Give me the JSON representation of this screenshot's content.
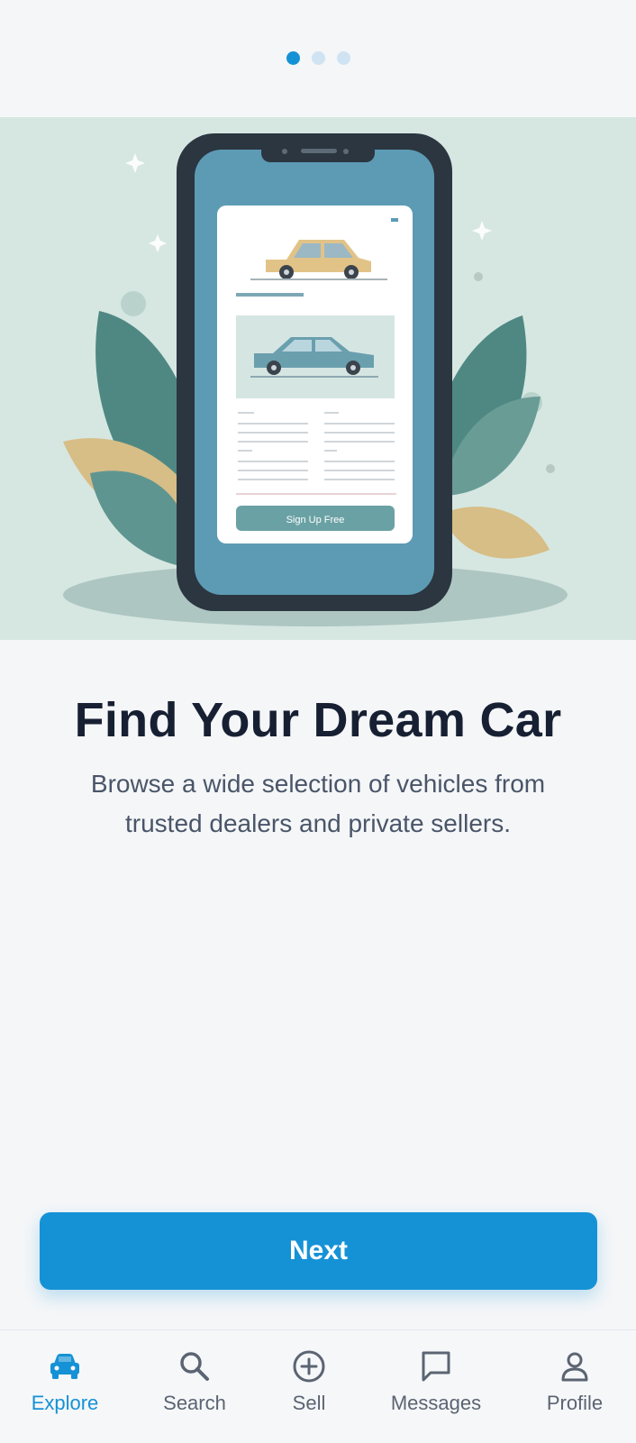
{
  "pagination": {
    "total": 3,
    "active_index": 0
  },
  "hero": {
    "illustration": "phone-with-car-listing",
    "mock_screen_text": "Sign Up Free"
  },
  "onboarding": {
    "title": "Find Your Dream Car",
    "subtitle": "Browse a wide selection of vehicles from trusted dealers and private sellers."
  },
  "actions": {
    "next_label": "Next"
  },
  "tabbar": {
    "items": [
      {
        "label": "Explore",
        "icon": "car-icon",
        "active": true
      },
      {
        "label": "Search",
        "icon": "search-icon",
        "active": false
      },
      {
        "label": "Sell",
        "icon": "plus-circle-icon",
        "active": false
      },
      {
        "label": "Messages",
        "icon": "message-icon",
        "active": false
      },
      {
        "label": "Profile",
        "icon": "user-icon",
        "active": false
      }
    ]
  },
  "colors": {
    "accent": "#1592d6",
    "text_dark": "#172033",
    "text_muted": "#4a5568"
  }
}
